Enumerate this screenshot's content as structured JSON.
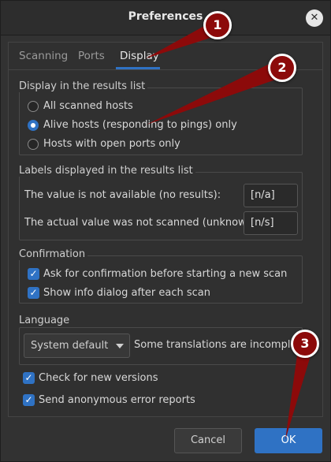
{
  "window": {
    "title": "Preferences",
    "close_glyph": "✕"
  },
  "tabs": [
    {
      "label": "Scanning",
      "active": false
    },
    {
      "label": "Ports",
      "active": false
    },
    {
      "label": "Display",
      "active": true
    }
  ],
  "display_group": {
    "title": "Display in the results list",
    "options": [
      {
        "label": "All scanned hosts",
        "selected": false
      },
      {
        "label": "Alive hosts (responding to pings) only",
        "selected": true
      },
      {
        "label": "Hosts with open ports only",
        "selected": false
      }
    ]
  },
  "labels_group": {
    "title": "Labels displayed in the results list",
    "not_available_label": "The value is not available (no results):",
    "not_available_value": "[n/a]",
    "not_scanned_label": "The actual value was not scanned (unknown):",
    "not_scanned_value": "[n/s]"
  },
  "confirmation_group": {
    "title": "Confirmation",
    "ask_confirmation": {
      "label": "Ask for confirmation before starting a new scan",
      "checked": true
    },
    "show_info": {
      "label": "Show info dialog after each scan",
      "checked": true
    }
  },
  "language_group": {
    "title": "Language",
    "selected": "System default",
    "note": "Some translations are incomplete"
  },
  "check_versions": {
    "label": "Check for new versions",
    "checked": true
  },
  "error_reports": {
    "label": "Send anonymous error reports",
    "checked": true
  },
  "buttons": {
    "cancel": "Cancel",
    "ok": "OK"
  },
  "annotations": {
    "color": "#8c0a0a",
    "badges": [
      {
        "number": "1"
      },
      {
        "number": "2"
      },
      {
        "number": "3"
      }
    ]
  },
  "icons": {
    "check": "check-icon",
    "close": "close-icon",
    "dropdown": "chevron-down-icon"
  }
}
